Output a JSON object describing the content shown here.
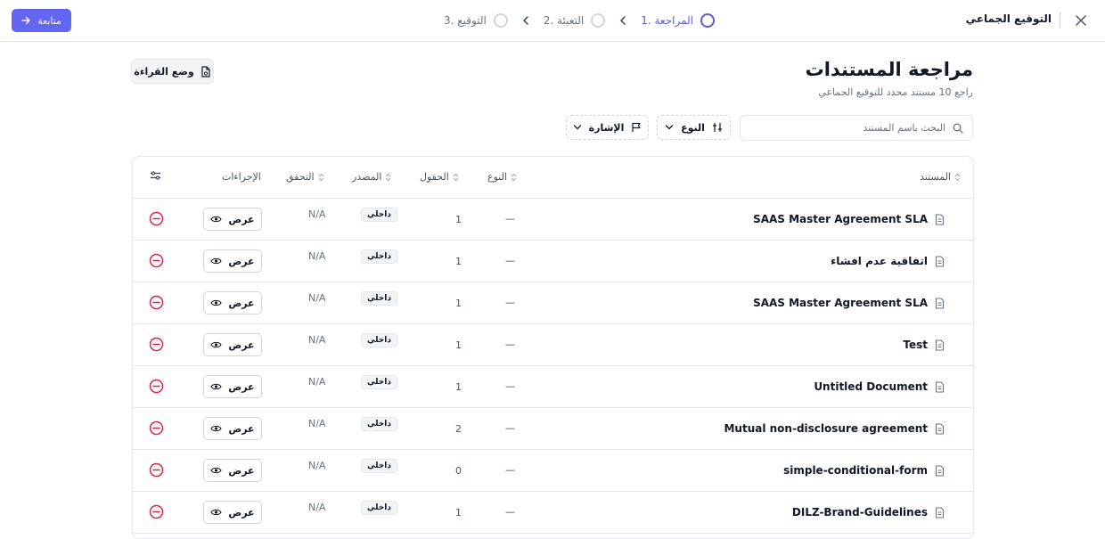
{
  "topbar": {
    "title": "التوقيع الجماعي",
    "continue_label": "متابعة",
    "steps": [
      {
        "label": "1. المراجعة",
        "state": "active"
      },
      {
        "label": "2. التعبئة",
        "state": "pending"
      },
      {
        "label": "3. التوقيع",
        "state": "pending"
      }
    ]
  },
  "header": {
    "title": "مراجعة المستندات",
    "subtitle": "راجع 10 مستند محدد للتوقيع الجماعي",
    "reading_mode_label": "وضع القراءة"
  },
  "filters": {
    "search_placeholder": "البحث باسم المستند",
    "type_label": "النوع",
    "signature_label": "الإشارة"
  },
  "table": {
    "columns": {
      "document": "المستند",
      "type": "النوع",
      "fields": "الحقول",
      "source": "المصدر",
      "verification": "التحقق",
      "actions": "الإجراءات"
    },
    "view_label": "عرض",
    "rows": [
      {
        "name": "SAAS Master Agreement SLA",
        "type": "—",
        "fields": "1",
        "source": "داخلي",
        "verification": "N/A"
      },
      {
        "name": "اتفاقية عدم افشاء",
        "type": "—",
        "fields": "1",
        "source": "داخلي",
        "verification": "N/A"
      },
      {
        "name": "SAAS Master Agreement SLA",
        "type": "—",
        "fields": "1",
        "source": "داخلي",
        "verification": "N/A"
      },
      {
        "name": "Test",
        "type": "—",
        "fields": "1",
        "source": "داخلي",
        "verification": "N/A"
      },
      {
        "name": "Untitled Document",
        "type": "—",
        "fields": "1",
        "source": "داخلي",
        "verification": "N/A"
      },
      {
        "name": "Mutual non-disclosure agreement",
        "type": "—",
        "fields": "2",
        "source": "داخلي",
        "verification": "N/A"
      },
      {
        "name": "simple-conditional-form",
        "type": "—",
        "fields": "0",
        "source": "داخلي",
        "verification": "N/A"
      },
      {
        "name": "DILZ-Brand-Guidelines",
        "type": "—",
        "fields": "1",
        "source": "داخلي",
        "verification": "N/A"
      }
    ]
  },
  "colors": {
    "accent": "#6366f1",
    "active_step": "#5b5bd6",
    "danger": "#e11d48"
  },
  "icons": {
    "close": "close-icon",
    "arrow": "arrow-right-icon",
    "chevron": "chevron-left-icon",
    "reading": "document-reading-icon",
    "search": "search-icon",
    "type": "filter-sliders-icon",
    "flag": "flag-icon",
    "sort": "sort-icon",
    "document": "document-icon",
    "eye": "eye-icon",
    "remove": "remove-circle-icon",
    "settings": "sliders-icon"
  }
}
